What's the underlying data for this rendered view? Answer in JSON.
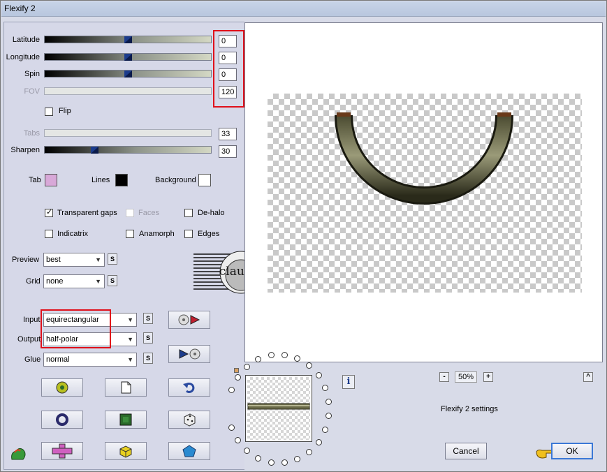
{
  "window": {
    "title": "Flexify 2"
  },
  "sliders": [
    {
      "label": "Latitude",
      "value": "0",
      "fraction": 0.5,
      "enabled": true
    },
    {
      "label": "Longitude",
      "value": "0",
      "fraction": 0.5,
      "enabled": true
    },
    {
      "label": "Spin",
      "value": "0",
      "fraction": 0.5,
      "enabled": true
    },
    {
      "label": "FOV",
      "value": "120",
      "enabled": false
    },
    {
      "label": "Tabs",
      "value": "33",
      "enabled": false
    },
    {
      "label": "Sharpen",
      "value": "30",
      "fraction": 0.3,
      "enabled": true
    }
  ],
  "flip": {
    "label": "Flip",
    "checked": false
  },
  "colors": {
    "tab": {
      "label": "Tab",
      "color": "#d8a8d8"
    },
    "lines": {
      "label": "Lines",
      "color": "#000000"
    },
    "background": {
      "label": "Background",
      "color": "#ffffff"
    }
  },
  "options": {
    "transparent_gaps": {
      "label": "Transparent gaps",
      "checked": true
    },
    "faces": {
      "label": "Faces",
      "checked": false,
      "enabled": false
    },
    "dehalo": {
      "label": "De-halo",
      "checked": false
    },
    "indicatrix": {
      "label": "Indicatrix",
      "checked": false
    },
    "anamorph": {
      "label": "Anamorph",
      "checked": false
    },
    "edges": {
      "label": "Edges",
      "checked": false
    }
  },
  "selects": {
    "preview": {
      "label": "Preview",
      "value": "best"
    },
    "grid": {
      "label": "Grid",
      "value": "none"
    },
    "input": {
      "label": "Input",
      "value": "equirectangular"
    },
    "output": {
      "label": "Output",
      "value": "half-polar"
    },
    "glue": {
      "label": "Glue",
      "value": "normal"
    }
  },
  "s_button_label": "S",
  "zoom": {
    "minus": "-",
    "value": "50%",
    "plus": "+"
  },
  "info_label": "i",
  "settings_name": "Flexify 2 settings",
  "buttons": {
    "cancel": "Cancel",
    "ok": "OK"
  },
  "scroll_up_label": "^",
  "watermark": {
    "text": "claudia"
  }
}
